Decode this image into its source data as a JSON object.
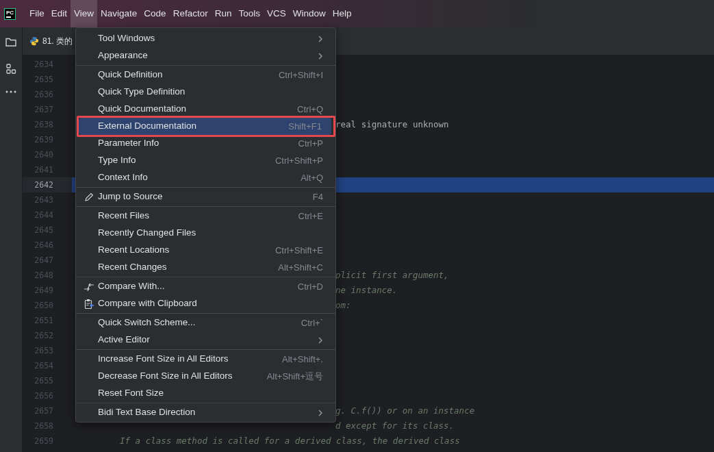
{
  "app_logo": "PC",
  "menubar": [
    {
      "label": "File",
      "selected": false
    },
    {
      "label": "Edit",
      "selected": false
    },
    {
      "label": "View",
      "selected": true
    },
    {
      "label": "Navigate",
      "selected": false
    },
    {
      "label": "Code",
      "selected": false
    },
    {
      "label": "Refactor",
      "selected": false
    },
    {
      "label": "Run",
      "selected": false
    },
    {
      "label": "Tools",
      "selected": false
    },
    {
      "label": "VCS",
      "selected": false
    },
    {
      "label": "Window",
      "selected": false
    },
    {
      "label": "Help",
      "selected": false
    }
  ],
  "editor_tab": {
    "label": "81. 类的"
  },
  "editor_lines": [
    {
      "number": "2634",
      "current": false
    },
    {
      "number": "2635",
      "current": false
    },
    {
      "number": "2636",
      "current": false
    },
    {
      "number": "2637",
      "current": false
    },
    {
      "number": "2638",
      "current": false,
      "code": "real signature unknown",
      "kind": "signature"
    },
    {
      "number": "2639",
      "current": false
    },
    {
      "number": "2640",
      "current": false
    },
    {
      "number": "2641",
      "current": false
    },
    {
      "number": "2642",
      "current": true
    },
    {
      "number": "2643",
      "current": false
    },
    {
      "number": "2644",
      "current": false
    },
    {
      "number": "2645",
      "current": false
    },
    {
      "number": "2646",
      "current": false
    },
    {
      "number": "2647",
      "current": false
    },
    {
      "number": "2648",
      "current": false,
      "code": "plicit first argument,",
      "kind": "docstring"
    },
    {
      "number": "2649",
      "current": false,
      "code": "ne instance.",
      "kind": "docstring"
    },
    {
      "number": "2650",
      "current": false,
      "code": "om:",
      "kind": "docstring"
    },
    {
      "number": "2651",
      "current": false
    },
    {
      "number": "2652",
      "current": false
    },
    {
      "number": "2653",
      "current": false
    },
    {
      "number": "2654",
      "current": false
    },
    {
      "number": "2655",
      "current": false
    },
    {
      "number": "2656",
      "current": false
    },
    {
      "number": "2657",
      "current": false,
      "code": "g. C.f()) or on an instance",
      "kind": "docstring"
    },
    {
      "number": "2658",
      "current": false,
      "code": "d except for its class.",
      "kind": "docstring"
    },
    {
      "number": "2659",
      "current": false,
      "code": "If a class method is called for a derived class, the derived class",
      "kind": "docindented"
    }
  ],
  "view_menu": {
    "callout_frame": true,
    "items": [
      {
        "kind": "item",
        "label": "Tool Windows",
        "submenu": true,
        "selected": false
      },
      {
        "kind": "item",
        "label": "Appearance",
        "submenu": true,
        "selected": false
      },
      {
        "kind": "separator"
      },
      {
        "kind": "item",
        "label": "Quick Definition",
        "shortcut": "Ctrl+Shift+I",
        "selected": false
      },
      {
        "kind": "item",
        "label": "Quick Type Definition",
        "selected": false
      },
      {
        "kind": "item",
        "label": "Quick Documentation",
        "shortcut": "Ctrl+Q",
        "selected": false
      },
      {
        "kind": "item",
        "label": "External Documentation",
        "shortcut": "Shift+F1",
        "selected": true
      },
      {
        "kind": "item",
        "label": "Parameter Info",
        "shortcut": "Ctrl+P",
        "selected": false
      },
      {
        "kind": "item",
        "label": "Type Info",
        "shortcut": "Ctrl+Shift+P",
        "selected": false
      },
      {
        "kind": "item",
        "label": "Context Info",
        "shortcut": "Alt+Q",
        "selected": false
      },
      {
        "kind": "separator"
      },
      {
        "kind": "edit",
        "label": "Jump to Source",
        "shortcut": "F4",
        "selected": false
      },
      {
        "kind": "separator"
      },
      {
        "kind": "item",
        "label": "Recent Files",
        "shortcut": "Ctrl+E",
        "selected": false
      },
      {
        "kind": "item",
        "label": "Recently Changed Files",
        "selected": false
      },
      {
        "kind": "item",
        "label": "Recent Locations",
        "shortcut": "Ctrl+Shift+E",
        "selected": false
      },
      {
        "kind": "item",
        "label": "Recent Changes",
        "shortcut": "Alt+Shift+C",
        "selected": false
      },
      {
        "kind": "separator"
      },
      {
        "kind": "compare",
        "label": "Compare With...",
        "shortcut": "Ctrl+D",
        "selected": false
      },
      {
        "kind": "clipboard",
        "label": "Compare with Clipboard",
        "selected": false
      },
      {
        "kind": "separator"
      },
      {
        "kind": "item",
        "label": "Quick Switch Scheme...",
        "shortcut": "Ctrl+`",
        "selected": false
      },
      {
        "kind": "item",
        "label": "Active Editor",
        "submenu": true,
        "selected": false
      },
      {
        "kind": "separator"
      },
      {
        "kind": "item",
        "label": "Increase Font Size in All Editors",
        "shortcut": "Alt+Shift+.",
        "selected": false
      },
      {
        "kind": "item",
        "label": "Decrease Font Size in All Editors",
        "shortcut": "Alt+Shift+逗号",
        "selected": false
      },
      {
        "kind": "item",
        "label": "Reset Font Size",
        "selected": false
      },
      {
        "kind": "separator"
      },
      {
        "kind": "item",
        "label": "Bidi Text Base Direction",
        "submenu": true,
        "selected": false
      }
    ]
  }
}
